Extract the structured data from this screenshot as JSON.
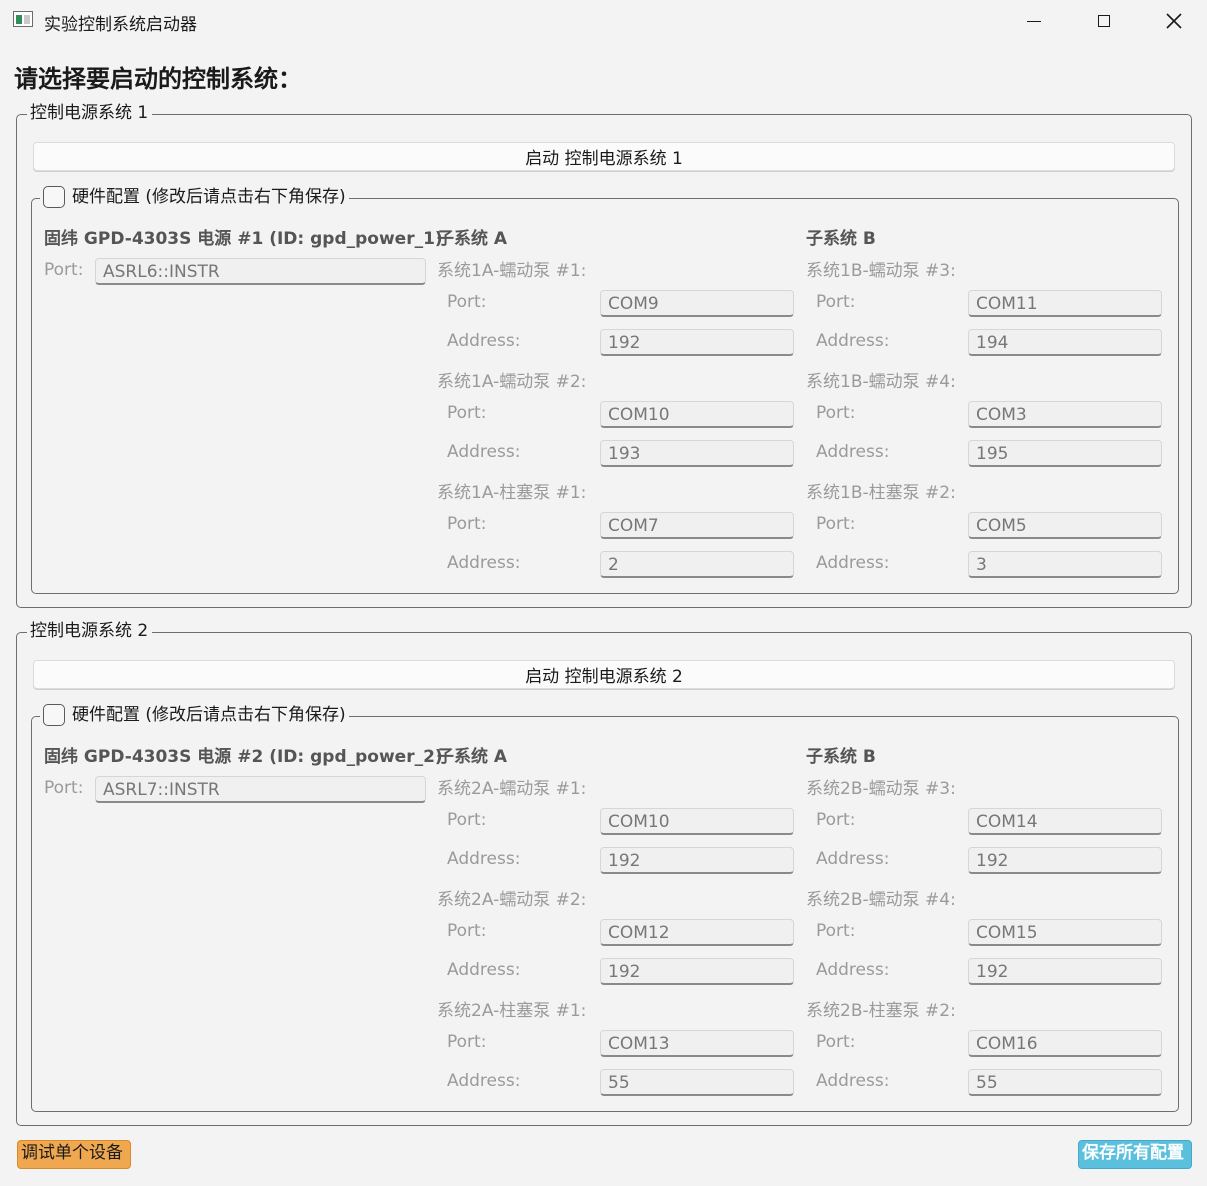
{
  "window": {
    "title": "实验控制系统启动器",
    "controls": {
      "minimize": "minimize-icon",
      "maximize": "maximize-icon",
      "close": "close-icon"
    }
  },
  "heading": "请选择要启动的控制系统：",
  "systems": [
    {
      "legend": "控制电源系统 1",
      "start_label": "启动 控制电源系统 1",
      "hw_label": "硬件配置 (修改后请点击右下角保存)",
      "power_label": "固纬 GPD-4303S 电源 #1 (ID: gpd_power_1)",
      "power_port_label": "Port:",
      "power_port": "ASRL6::INSTR",
      "sub_a": {
        "label": "子系统 A",
        "devices": [
          {
            "name": "系统1A-蠕动泵 #1:",
            "port_label": "Port:",
            "port": "COM9",
            "address_label": "Address:",
            "address": "192"
          },
          {
            "name": "系统1A-蠕动泵 #2:",
            "port_label": "Port:",
            "port": "COM10",
            "address_label": "Address:",
            "address": "193"
          },
          {
            "name": "系统1A-柱塞泵 #1:",
            "port_label": "Port:",
            "port": "COM7",
            "address_label": "Address:",
            "address": "2"
          }
        ]
      },
      "sub_b": {
        "label": "子系统 B",
        "devices": [
          {
            "name": "系统1B-蠕动泵 #3:",
            "port_label": "Port:",
            "port": "COM11",
            "address_label": "Address:",
            "address": "194"
          },
          {
            "name": "系统1B-蠕动泵 #4:",
            "port_label": "Port:",
            "port": "COM3",
            "address_label": "Address:",
            "address": "195"
          },
          {
            "name": "系统1B-柱塞泵 #2:",
            "port_label": "Port:",
            "port": "COM5",
            "address_label": "Address:",
            "address": "3"
          }
        ]
      }
    },
    {
      "legend": "控制电源系统 2",
      "start_label": "启动 控制电源系统 2",
      "hw_label": "硬件配置 (修改后请点击右下角保存)",
      "power_label": "固纬 GPD-4303S 电源 #2 (ID: gpd_power_2)",
      "power_port_label": "Port:",
      "power_port": "ASRL7::INSTR",
      "sub_a": {
        "label": "子系统 A",
        "devices": [
          {
            "name": "系统2A-蠕动泵 #1:",
            "port_label": "Port:",
            "port": "COM10",
            "address_label": "Address:",
            "address": "192"
          },
          {
            "name": "系统2A-蠕动泵 #2:",
            "port_label": "Port:",
            "port": "COM12",
            "address_label": "Address:",
            "address": "192"
          },
          {
            "name": "系统2A-柱塞泵 #1:",
            "port_label": "Port:",
            "port": "COM13",
            "address_label": "Address:",
            "address": "55"
          }
        ]
      },
      "sub_b": {
        "label": "子系统 B",
        "devices": [
          {
            "name": "系统2B-蠕动泵 #3:",
            "port_label": "Port:",
            "port": "COM14",
            "address_label": "Address:",
            "address": "192"
          },
          {
            "name": "系统2B-蠕动泵 #4:",
            "port_label": "Port:",
            "port": "COM15",
            "address_label": "Address:",
            "address": "192"
          },
          {
            "name": "系统2B-柱塞泵 #2:",
            "port_label": "Port:",
            "port": "COM16",
            "address_label": "Address:",
            "address": "55"
          }
        ]
      }
    }
  ],
  "footer": {
    "debug_label": "调试单个设备",
    "debug_color": "#f0a850",
    "save_label": "保存所有配置",
    "save_color": "#5bc0de"
  }
}
